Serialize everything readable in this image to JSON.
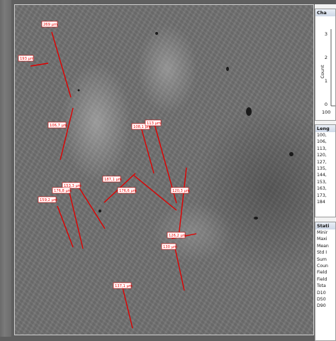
{
  "measurements": [
    {
      "label": "269 µm"
    },
    {
      "label": "193 µm"
    },
    {
      "label": "106,7 µm"
    },
    {
      "label": "108,1 µm"
    },
    {
      "label": "113 µm"
    },
    {
      "label": "187,1 µm"
    },
    {
      "label": "176,6 µm"
    },
    {
      "label": "120,3 µm"
    },
    {
      "label": "153,3 µm"
    },
    {
      "label": "176,8 µm"
    },
    {
      "label": "159,2 µm"
    },
    {
      "label": "126,2 µm"
    },
    {
      "label": "130 µm"
    },
    {
      "label": "137,1 µm"
    }
  ],
  "chart_panel": {
    "title": "Cha",
    "ylabel": "Count",
    "yticks": [
      "3",
      "2",
      "1",
      "0"
    ],
    "xtick": "100"
  },
  "length_panel": {
    "title": "Leng",
    "items": [
      "100,",
      "106,",
      "113,",
      "120,",
      "127,",
      "135,",
      "144,",
      "153,",
      "163,",
      "173,",
      "184"
    ]
  },
  "stats_panel": {
    "title": "Stati",
    "items": [
      "Minir",
      "Maxi",
      "Mean",
      "Std I",
      "Sum",
      "Coun",
      "Field",
      "Field",
      "Tota",
      "D10",
      "D50",
      "D90"
    ]
  },
  "colors": {
    "measure_red": "#e00000",
    "background": "#727272"
  }
}
